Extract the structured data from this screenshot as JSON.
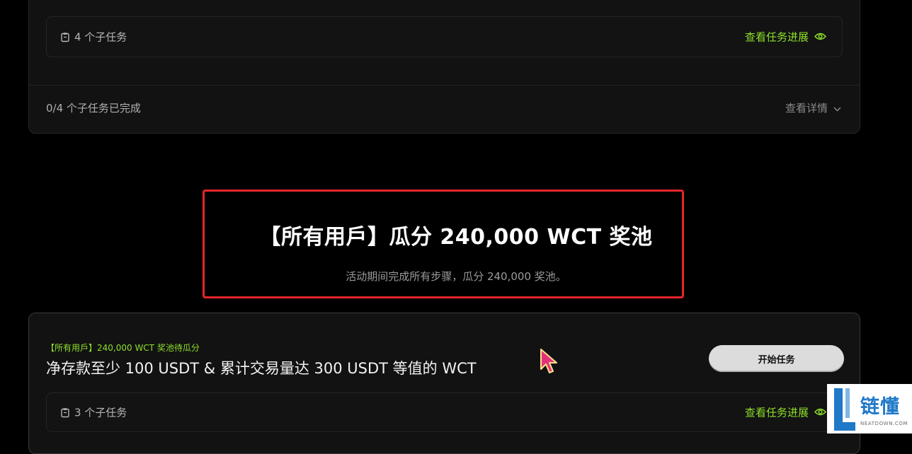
{
  "top_card": {
    "subtask_count": "4 个子任务",
    "view_progress": "查看任务进展",
    "completed": "0/4 个子任务已完成",
    "view_details": "查看详情"
  },
  "pool": {
    "title": "【所有用戶】瓜分 240,000 WCT 奖池",
    "subtitle": "活动期间完成所有步骤，瓜分 240,000 奖池。"
  },
  "bottom_card": {
    "tag": "【所有用戶】240,000 WCT 奖池待瓜分",
    "title": "净存款至少 100 USDT & 累计交易量达 300 USDT 等值的 WCT",
    "start_button": "开始任务",
    "subtask_count": "3 个子任务",
    "view_progress": "查看任务进展"
  },
  "watermark": {
    "brand": "链懂",
    "site": "NEATDOWN.COM"
  },
  "colors": {
    "accent_green": "#8ee02a",
    "highlight_red": "#e5262b",
    "brand_blue": "#1f78c8"
  }
}
